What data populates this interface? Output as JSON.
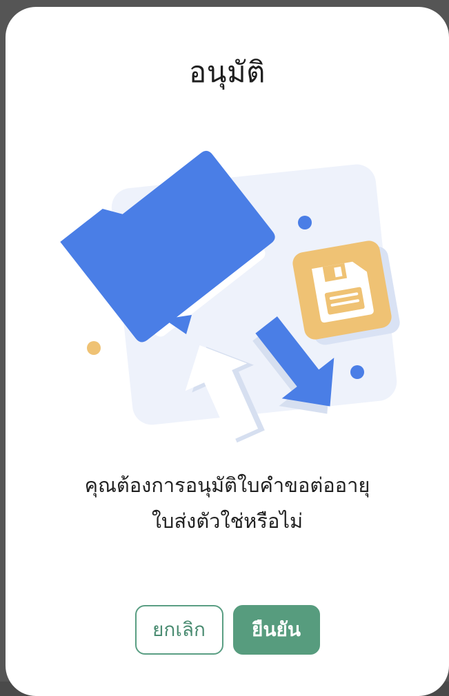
{
  "dialog": {
    "title": "อนุมัติ",
    "message_line1": "คุณต้องการอนุมัติใบคำขอต่ออายุ",
    "message_line2": "ใบส่งตัวใช่หรือไม่",
    "illustration": "folder-save-document-icon"
  },
  "actions": {
    "cancel_label": "ยกเลิก",
    "confirm_label": "ยืนยัน"
  },
  "colors": {
    "primary_green": "#579c7e",
    "folder_blue": "#4a7ee6",
    "accent_yellow": "#efc274",
    "panel_background": "#eef2fb"
  }
}
